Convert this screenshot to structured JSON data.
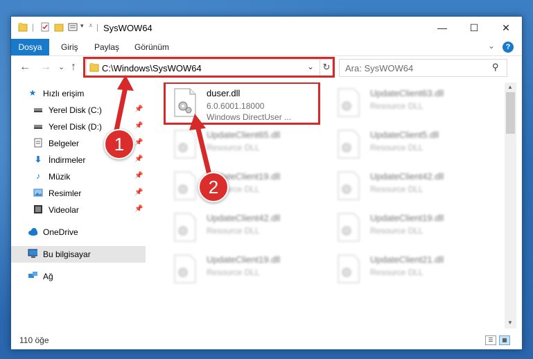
{
  "window": {
    "title": "SysWOW64",
    "minimize": "—",
    "maximize": "☐",
    "close": "✕"
  },
  "ribbon": {
    "tabs": [
      "Dosya",
      "Giriş",
      "Paylaş",
      "Görünüm"
    ],
    "help": "?"
  },
  "nav": {
    "back": "←",
    "forward": "→",
    "recent": "⌄",
    "up": "↑",
    "address": "C:\\Windows\\SysWOW64",
    "refresh": "↻",
    "search_placeholder": "Ara: SysWOW64"
  },
  "sidebar": {
    "items": [
      {
        "label": "Hızlı erişim",
        "icon": "star-icon",
        "pinned": false
      },
      {
        "label": "Yerel Disk (C:)",
        "icon": "drive-icon",
        "pinned": true
      },
      {
        "label": "Yerel Disk (D:)",
        "icon": "drive-icon",
        "pinned": true
      },
      {
        "label": "Belgeler",
        "icon": "document-icon",
        "pinned": true
      },
      {
        "label": "İndirmeler",
        "icon": "download-icon",
        "pinned": true
      },
      {
        "label": "Müzik",
        "icon": "music-icon",
        "pinned": true
      },
      {
        "label": "Resimler",
        "icon": "pictures-icon",
        "pinned": true
      },
      {
        "label": "Videolar",
        "icon": "videos-icon",
        "pinned": true
      },
      {
        "label": "OneDrive",
        "icon": "cloud-icon",
        "pinned": false
      },
      {
        "label": "Bu bilgisayar",
        "icon": "computer-icon",
        "pinned": false,
        "selected": true
      },
      {
        "label": "Ağ",
        "icon": "network-icon",
        "pinned": false
      }
    ]
  },
  "files": {
    "highlighted": {
      "name": "duser.dll",
      "version": "6.0.6001.18000",
      "description": "Windows DirectUser ..."
    },
    "others": [
      {
        "name": "UpdateClient63.dll",
        "description": "Resource DLL"
      },
      {
        "name": "UpdateClient65.dll",
        "description": "Resource DLL"
      },
      {
        "name": "UpdateClient5.dll",
        "description": "Resource DLL"
      },
      {
        "name": "UpdateClient19.dll",
        "description": "Resource DLL"
      },
      {
        "name": "UpdateClient42.dll",
        "description": "Resource DLL"
      },
      {
        "name": "UpdateClient42.dll",
        "description": "Resource DLL"
      },
      {
        "name": "UpdateClient19.dll",
        "description": "Resource DLL"
      },
      {
        "name": "UpdateClient19.dll",
        "description": "Resource DLL"
      },
      {
        "name": "UpdateClient21.dll",
        "description": "Resource DLL"
      }
    ]
  },
  "status": {
    "item_count": "110 öğe"
  },
  "annotations": {
    "step1": "1",
    "step2": "2",
    "color": "#d62a2a"
  }
}
